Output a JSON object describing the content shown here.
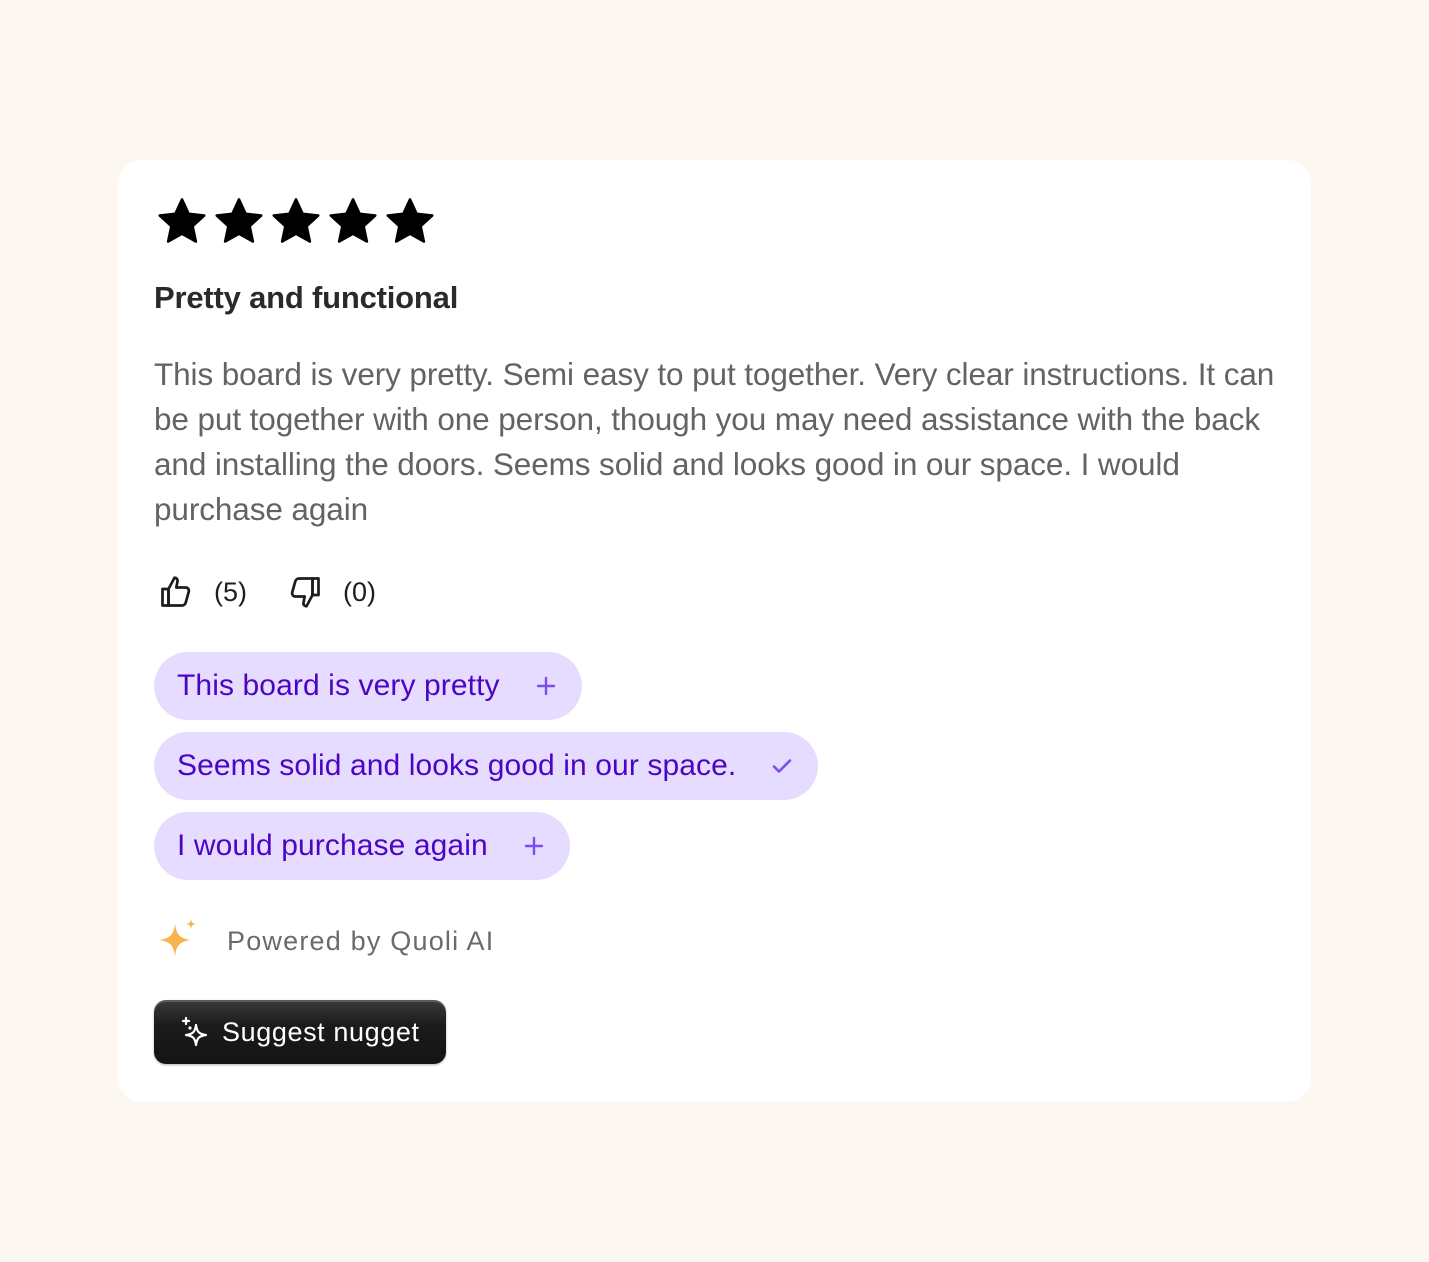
{
  "review": {
    "rating": 5,
    "max_rating": 5,
    "title": "Pretty and functional",
    "body": "This board is very pretty. Semi easy to put together. Very clear instructions. It can be put together with one person, though you may need assistance with the back and installing the doors. Seems solid and looks good in our space. I would purchase again"
  },
  "votes": {
    "upvotes": "(5)",
    "downvotes": "(0)",
    "up_icon": "thumbs-up-icon",
    "down_icon": "thumbs-down-icon"
  },
  "nuggets": [
    {
      "label": "This board is very pretty",
      "state": "add",
      "icon": "plus-icon"
    },
    {
      "label": "Seems solid and looks good in our space.",
      "state": "added",
      "icon": "check-icon"
    },
    {
      "label": "I would purchase again",
      "state": "add",
      "icon": "plus-icon"
    }
  ],
  "powered_by": {
    "label": "Powered by Quoli AI",
    "icon": "sparkle-icon"
  },
  "suggest_button": {
    "label": "Suggest nugget",
    "icon": "sparkle-icon"
  },
  "colors": {
    "page_background": "#fdf7f1",
    "card_background": "#ffffff",
    "chip_background": "#e5dcff",
    "chip_text": "#4d05c4",
    "chip_icon": "#7c4dea",
    "sparkle": "#f9b24c",
    "button_background": "#1b1b1b"
  }
}
